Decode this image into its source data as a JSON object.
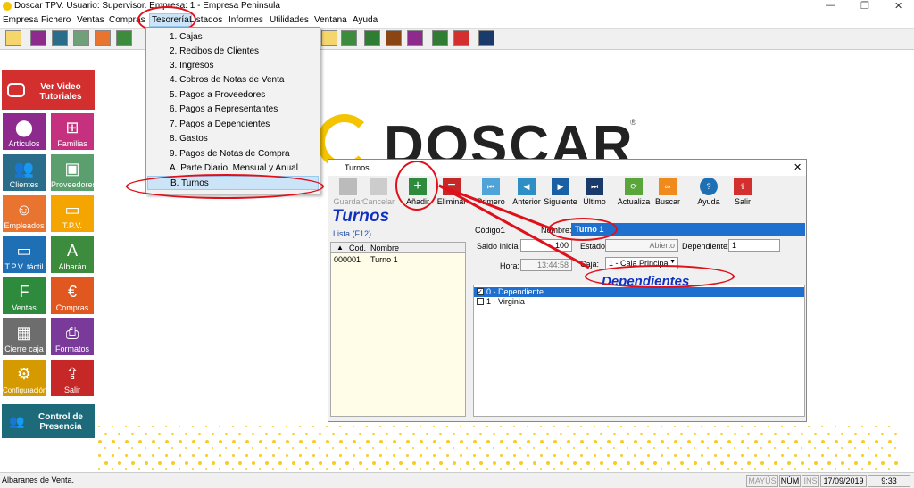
{
  "window": {
    "title": "Doscar TPV. Usuario: Supervisor. Empresa: 1 - Empresa Peninsula"
  },
  "menu": [
    "Empresa",
    "Fichero",
    "Ventas",
    "Compras",
    "Tesorería",
    "Listados",
    "Informes",
    "Utilidades",
    "Ventana",
    "Ayuda"
  ],
  "dropdown": {
    "items": [
      "1. Cajas",
      "2. Recibos de Clientes",
      "3. Ingresos",
      "4. Cobros de Notas de Venta",
      "5. Pagos a Proveedores",
      "6. Pagos a Representantes",
      "7. Pagos a Dependientes",
      "8. Gastos",
      "9. Pagos de Notas de Compra",
      "A. Parte Diario, Mensual y Anual",
      "B. Turnos"
    ]
  },
  "sidebar": {
    "video": "Ver Video Tutoriales",
    "tiles": [
      "Artículos",
      "Familias",
      "Clientes",
      "Proveedores",
      "Empleados",
      "T.P.V.",
      "T.P.V. táctil",
      "Albarán",
      "Ventas",
      "Compras",
      "Cierre caja",
      "Formatos",
      "Configuración",
      "Salir"
    ],
    "control": "Control de Presencia"
  },
  "logo": {
    "text": "DOSCAR",
    "reg": "®"
  },
  "dialog": {
    "title": "Turnos",
    "heading": "Turnos",
    "list_link": "Lista (F12)",
    "buttons": [
      "Guardar",
      "Cancelar",
      "Añadir",
      "Eliminar",
      "Primero",
      "Anterior",
      "Siguiente",
      "Último",
      "Actualiza",
      "Buscar",
      "Ayuda",
      "Salir"
    ],
    "list": {
      "col_cod": "Cod.",
      "col_nombre": "Nombre",
      "row_cod": "000001",
      "row_nombre": "Turno 1"
    },
    "form": {
      "codigo_label": "Código:",
      "codigo": "1",
      "nombre_label": "Nombre:",
      "nombre": "Turno 1",
      "saldo_label": "Saldo Inicial:",
      "saldo": "100",
      "estado_label": "Estado:",
      "estado": "Abierto",
      "dependiente_label": "Dependiente:",
      "dependiente": "1",
      "hora_label": "Hora:",
      "hora": "13:44:58",
      "caja_label": "Caja:",
      "caja": "1 - Caja Principal"
    },
    "dependientes": [
      "0 - Dependiente",
      "1 - Virginia"
    ],
    "annotation": "Dependientes"
  },
  "status": {
    "text": "Albaranes de Venta.",
    "mayus": "MAYÚS",
    "num": "NÚM",
    "ins": "INS",
    "date": "17/09/2019",
    "time": "9:33"
  }
}
